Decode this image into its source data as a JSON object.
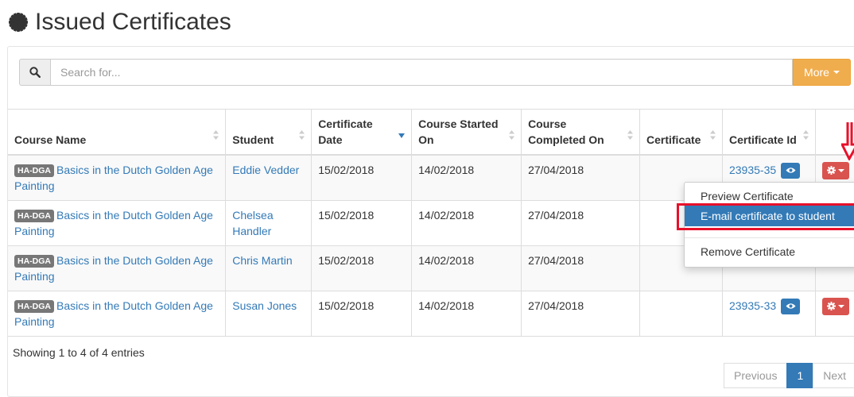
{
  "page": {
    "title": "Issued Certificates",
    "icon": "gear-icon"
  },
  "search": {
    "placeholder": "Search for...",
    "more_label": "More"
  },
  "table": {
    "columns": [
      "Course Name",
      "Student",
      "Certificate Date",
      "Course Started On",
      "Course Completed On",
      "Certificate",
      "Certificate Id"
    ],
    "rows": [
      {
        "code": "HA-DGA",
        "course": "Basics in the Dutch Golden Age Painting",
        "student": "Eddie Vedder",
        "cert_date": "15/02/2018",
        "started": "14/02/2018",
        "completed": "27/04/2018",
        "certificate": "",
        "cert_id": "23935-35"
      },
      {
        "code": "HA-DGA",
        "course": "Basics in the Dutch Golden Age Painting",
        "student": "Chelsea Handler",
        "cert_date": "15/02/2018",
        "started": "14/02/2018",
        "completed": "27/04/2018",
        "certificate": "",
        "cert_id": ""
      },
      {
        "code": "HA-DGA",
        "course": "Basics in the Dutch Golden Age Painting",
        "student": "Chris Martin",
        "cert_date": "15/02/2018",
        "started": "14/02/2018",
        "completed": "27/04/2018",
        "certificate": "",
        "cert_id": ""
      },
      {
        "code": "HA-DGA",
        "course": "Basics in the Dutch Golden Age Painting",
        "student": "Susan Jones",
        "cert_date": "15/02/2018",
        "started": "14/02/2018",
        "completed": "27/04/2018",
        "certificate": "",
        "cert_id": "23935-33"
      }
    ]
  },
  "dropdown": {
    "items": [
      "Preview Certificate",
      "E-mail certificate to student",
      "Remove Certificate"
    ],
    "active_index": 1
  },
  "footer": {
    "info": "Showing 1 to 4 of 4 entries"
  },
  "pagination": {
    "previous": "Previous",
    "current": "1",
    "next": "Next"
  },
  "colors": {
    "primary": "#337ab7",
    "warning": "#f0ad4e",
    "danger": "#d9534f",
    "highlight": "#e8102a",
    "badge": "#777777"
  }
}
